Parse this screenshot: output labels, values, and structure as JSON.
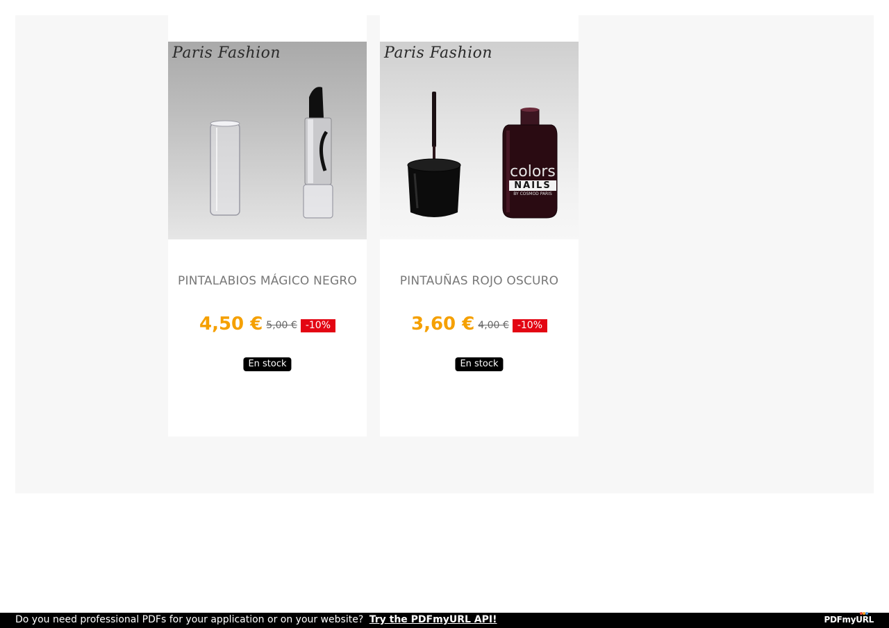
{
  "products": [
    {
      "brand_watermark": "Paris Fashion",
      "title": "PINTALABIOS MÁGICO NEGRO",
      "price": "4,50 €",
      "old_price": "5,00 €",
      "discount": "-10%",
      "stock": "En stock",
      "image_icon": "lipstick-image"
    },
    {
      "brand_watermark": "Paris Fashion",
      "title": "PINTAUÑAS ROJO OSCURO",
      "price": "3,60 €",
      "old_price": "4,00 €",
      "discount": "-10%",
      "stock": "En stock",
      "image_icon": "nail-polish-image",
      "label_line1": "colors",
      "label_line2": "NAILS",
      "label_line3": "BY COSMOD PARIS"
    }
  ],
  "footer": {
    "text": "Do you need professional PDFs for your application or on your website?",
    "link": "Try the PDFmyURL API!",
    "logo": "PDFmyURL"
  },
  "colors": {
    "price": "#f5a000",
    "discount_badge": "#e30613",
    "stock_badge": "#000000",
    "panel_background": "#f7f7f7"
  }
}
